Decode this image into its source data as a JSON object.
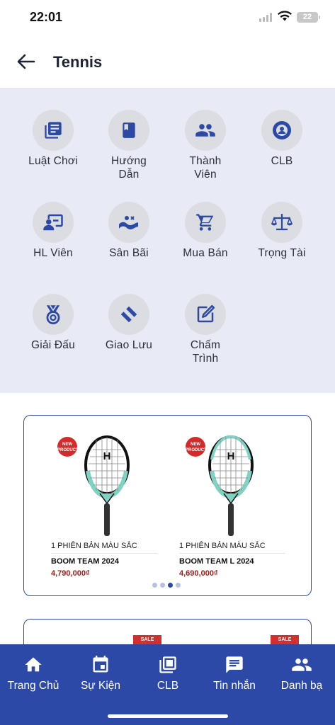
{
  "status": {
    "time": "22:01",
    "battery": "22"
  },
  "header": {
    "title": "Tennis"
  },
  "categories": [
    {
      "label": "Luật Chơi",
      "icon": "rules-book-icon"
    },
    {
      "label": "Hướng Dẫn",
      "icon": "guide-book-icon"
    },
    {
      "label": "Thành Viên",
      "icon": "members-icon"
    },
    {
      "label": "CLB",
      "icon": "club-icon"
    },
    {
      "label": "HL Viên",
      "icon": "coach-icon"
    },
    {
      "label": "Sân Bãi",
      "icon": "court-icon"
    },
    {
      "label": "Mua Bán",
      "icon": "cart-icon"
    },
    {
      "label": "Trọng Tài",
      "icon": "scale-icon"
    },
    {
      "label": "Giải Đấu",
      "icon": "medal-icon"
    },
    {
      "label": "Giao Lưu",
      "icon": "handshake-icon"
    },
    {
      "label": "Chấm Trình",
      "icon": "edit-icon"
    }
  ],
  "products": [
    {
      "badge": "NEW PRODUCTS",
      "caption": "1 PHIÊN BẢN MÀU SẮC",
      "name": "BOOM TEAM 2024",
      "price": "4,790,000₫"
    },
    {
      "badge": "NEW PRODUCTS",
      "caption": "1 PHIÊN BẢN MÀU SẮC",
      "name": "BOOM TEAM L 2024",
      "price": "4,690,000₫"
    }
  ],
  "carousel": {
    "count": 4,
    "active": 3
  },
  "banner2": {
    "sale_label": "SALE"
  },
  "bottom_nav": [
    {
      "label": "Trang Chủ",
      "icon": "home-icon"
    },
    {
      "label": "Sự Kiện",
      "icon": "calendar-icon"
    },
    {
      "label": "CLB",
      "icon": "library-icon"
    },
    {
      "label": "Tin nhắn",
      "icon": "message-icon"
    },
    {
      "label": "Danh bạ",
      "icon": "contacts-icon"
    }
  ],
  "colors": {
    "primary": "#2d49a8",
    "grid_bg": "#e8ebf5",
    "icon": "#2c4aa5",
    "price": "#a31d1d",
    "badge": "#d62a2a"
  }
}
